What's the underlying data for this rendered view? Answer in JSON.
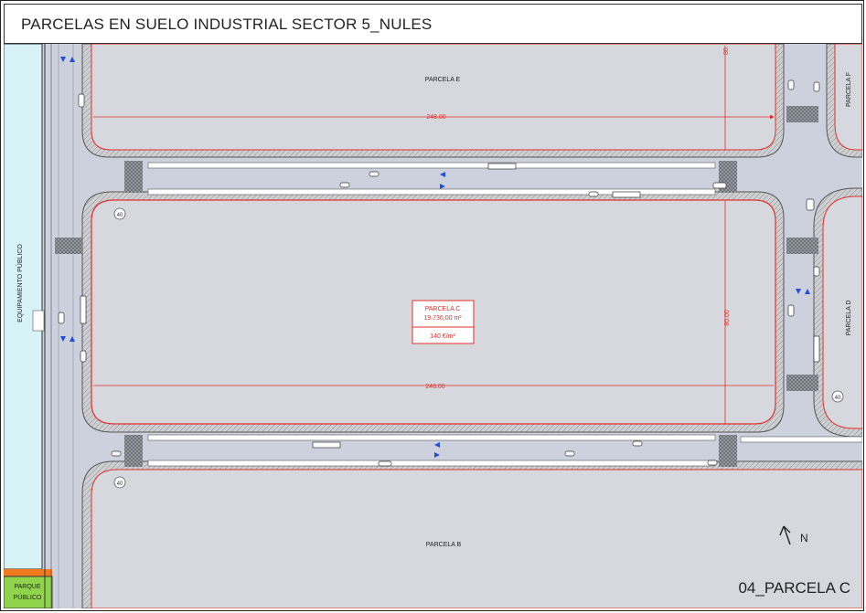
{
  "title": "PARCELAS EN SUELO INDUSTRIAL SECTOR 5_NULES",
  "sheet_label": "04_PARCELA C",
  "parcels": {
    "e": "PARCELA E",
    "f": "PARCELA F",
    "d": "PARCELA D",
    "b": "PARCELA B",
    "c": {
      "name": "PARCELA C",
      "area": "19.736,00 m²",
      "price": "140 €/m²"
    }
  },
  "dimensions": {
    "width": "248.00",
    "depth": "80.00"
  },
  "equipamiento_label": "EQUIPAMIENTO PÚBLICO",
  "parque_label": "PARQUE PÚBLICO",
  "north_label": "N",
  "speed_sign": "40",
  "colors": {
    "parcel_fill": "#d7d8dd",
    "road": "#c8cbd6",
    "boundary": "#e0302a",
    "equipamiento": "#d8f3f8",
    "parque": "#8fd44a",
    "parque_strip": "#f07a1e",
    "arrow": "#1f4fd6"
  }
}
